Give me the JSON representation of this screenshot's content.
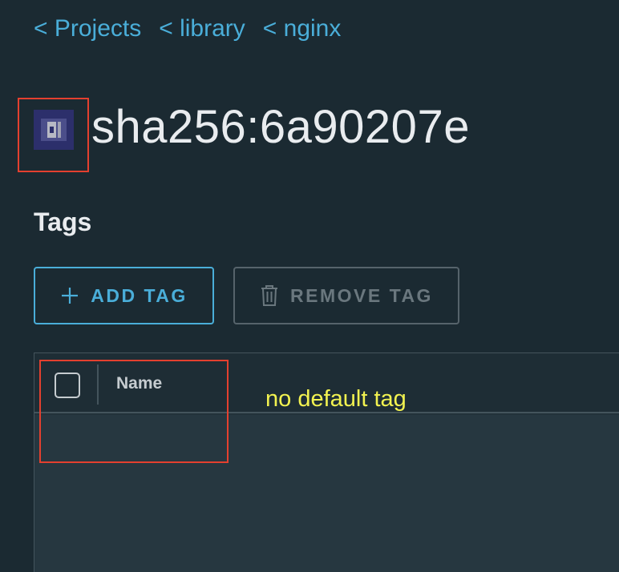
{
  "breadcrumb": [
    {
      "label": "< Projects"
    },
    {
      "label": "< library"
    },
    {
      "label": "< nginx"
    }
  ],
  "header": {
    "icon": "artifact-image-icon",
    "title": "sha256:6a90207e"
  },
  "tags_section": {
    "title": "Tags",
    "add_button": {
      "label": "ADD TAG",
      "icon": "plus-icon"
    },
    "remove_button": {
      "label": "REMOVE TAG",
      "icon": "trash-icon"
    }
  },
  "table": {
    "columns": [
      "Name"
    ]
  },
  "annotation": {
    "text": "no default tag",
    "highlight_color": "#e4402f",
    "text_color": "#f2f250"
  },
  "colors": {
    "background": "#1b2a32",
    "accent": "#4aaed9",
    "disabled": "#6a777e"
  }
}
